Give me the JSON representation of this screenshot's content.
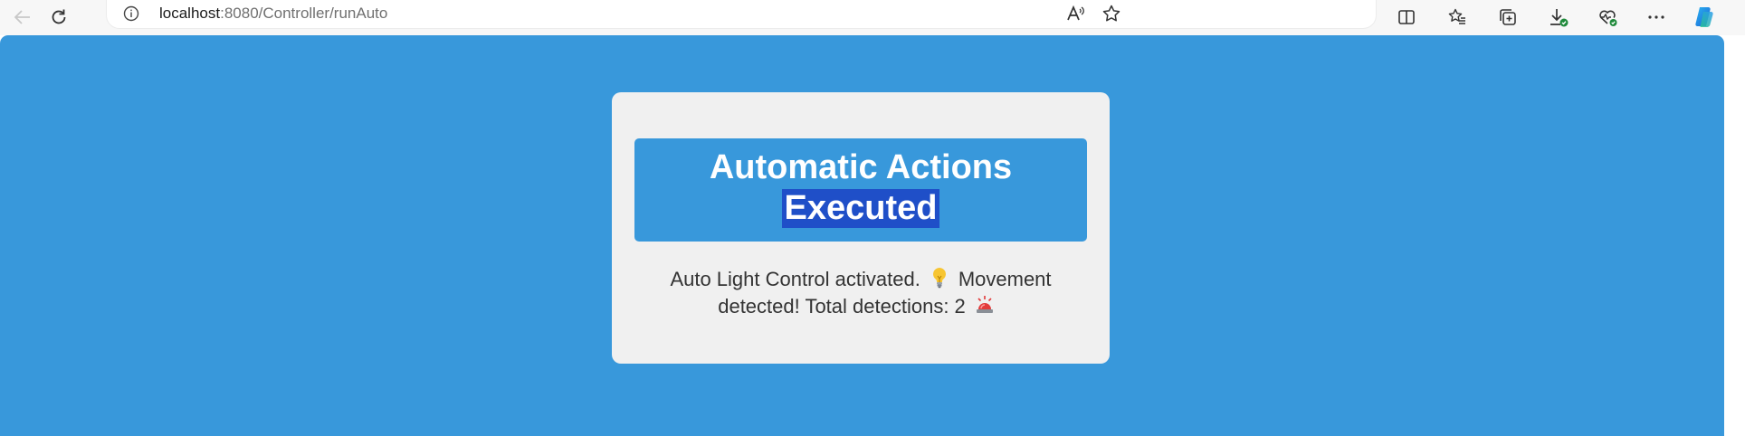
{
  "browser": {
    "url_host": "localhost",
    "url_rest": ":8080/Controller/runAuto",
    "icons": [
      "back-icon",
      "refresh-icon",
      "info-icon",
      "read-aloud-icon",
      "favorite-star-icon",
      "split-screen-icon",
      "favorites-icon",
      "collections-icon",
      "downloads-icon",
      "browser-essentials-icon",
      "more-icon",
      "copilot-icon"
    ]
  },
  "page": {
    "background": "#3898db",
    "card_background": "#f0f0f0",
    "title_line1": "Automatic Actions",
    "title_line2": "Executed",
    "message_part1": "Auto Light Control activated.",
    "message_part2": "Movement detected! Total detections: 2",
    "emoji_1": "lightbulb-icon",
    "emoji_2": "police-light-icon"
  }
}
